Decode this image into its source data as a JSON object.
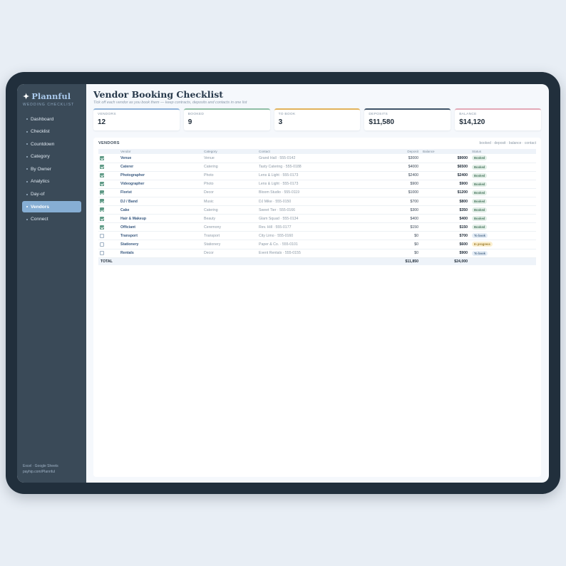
{
  "app": {
    "name": "Plannful",
    "subtitle": "WEDDING CHECKLIST",
    "footer_line1": "Excel · Google Sheets",
    "footer_line2": "payhip.com/Plannful"
  },
  "nav": [
    {
      "label": "Dashboard",
      "active": false
    },
    {
      "label": "Checklist",
      "active": false
    },
    {
      "label": "Countdown",
      "active": false
    },
    {
      "label": "Category",
      "active": false
    },
    {
      "label": "By Owner",
      "active": false
    },
    {
      "label": "Analytics",
      "active": false
    },
    {
      "label": "Day-of",
      "active": false
    },
    {
      "label": "Vendors",
      "active": true
    },
    {
      "label": "Connect",
      "active": false
    }
  ],
  "page": {
    "title": "Vendor Booking Checklist",
    "tagline": "Tick off each vendor as you book them — keep contracts, deposits and contacts in one list"
  },
  "cards": [
    {
      "label": "VENDORS",
      "value": "12",
      "color": "#8fb3d9"
    },
    {
      "label": "BOOKED",
      "value": "9",
      "color": "#8fbfa6"
    },
    {
      "label": "TO BOOK",
      "value": "3",
      "color": "#e2b35b"
    },
    {
      "label": "DEPOSITS",
      "value": "$11,580",
      "color": "#3f5368"
    },
    {
      "label": "BALANCE",
      "value": "$14,120",
      "color": "#e3a9b7"
    }
  ],
  "panel": {
    "title": "VENDORS",
    "hint": "booked · deposit · balance · contact"
  },
  "table": {
    "headers": [
      "",
      "Vendor",
      "Category",
      "Contact",
      "Deposit",
      "Balance",
      "Status"
    ],
    "rows": [
      {
        "checked": true,
        "vendor": "Venue",
        "category": "Venue",
        "contact": "Grand Hall · 555-0142",
        "deposit": "$3000",
        "balance": "$9000",
        "status": "Booked",
        "status_type": "booked"
      },
      {
        "checked": true,
        "vendor": "Caterer",
        "category": "Catering",
        "contact": "Tasty Catering · 555-0188",
        "deposit": "$4000",
        "balance": "$6500",
        "status": "Booked",
        "status_type": "booked"
      },
      {
        "checked": true,
        "vendor": "Photographer",
        "category": "Photo",
        "contact": "Lens & Light · 555-0173",
        "deposit": "$2400",
        "balance": "$2400",
        "status": "Booked",
        "status_type": "booked"
      },
      {
        "checked": true,
        "vendor": "Videographer",
        "category": "Photo",
        "contact": "Lens & Light · 555-0173",
        "deposit": "$900",
        "balance": "$900",
        "status": "Booked",
        "status_type": "booked"
      },
      {
        "checked": true,
        "vendor": "Florist",
        "category": "Decor",
        "contact": "Bloom Studio · 555-0119",
        "deposit": "$1000",
        "balance": "$1200",
        "status": "Booked",
        "status_type": "booked"
      },
      {
        "checked": true,
        "vendor": "DJ / Band",
        "category": "Music",
        "contact": "DJ Mike · 555-0150",
        "deposit": "$700",
        "balance": "$800",
        "status": "Booked",
        "status_type": "booked"
      },
      {
        "checked": true,
        "vendor": "Cake",
        "category": "Catering",
        "contact": "Sweet Tier · 555-0166",
        "deposit": "$300",
        "balance": "$350",
        "status": "Booked",
        "status_type": "booked"
      },
      {
        "checked": true,
        "vendor": "Hair & Makeup",
        "category": "Beauty",
        "contact": "Glam Squad · 555-0134",
        "deposit": "$400",
        "balance": "$400",
        "status": "Booked",
        "status_type": "booked"
      },
      {
        "checked": true,
        "vendor": "Officiant",
        "category": "Ceremony",
        "contact": "Rev. Hill · 555-0177",
        "deposit": "$150",
        "balance": "$150",
        "status": "Booked",
        "status_type": "booked"
      },
      {
        "checked": false,
        "vendor": "Transport",
        "category": "Transport",
        "contact": "City Limo · 555-0160",
        "deposit": "$0",
        "balance": "$700",
        "status": "To book",
        "status_type": "tobook"
      },
      {
        "checked": false,
        "vendor": "Stationery",
        "category": "Stationery",
        "contact": "Paper & Co. · 555-0101",
        "deposit": "$0",
        "balance": "$600",
        "status": "In progress",
        "status_type": "progress"
      },
      {
        "checked": false,
        "vendor": "Rentals",
        "category": "Decor",
        "contact": "Event Rentals · 555-0155",
        "deposit": "$0",
        "balance": "$900",
        "status": "To book",
        "status_type": "tobook"
      }
    ],
    "total": {
      "label": "TOTAL",
      "deposit": "$11,850",
      "balance": "$24,000"
    }
  }
}
